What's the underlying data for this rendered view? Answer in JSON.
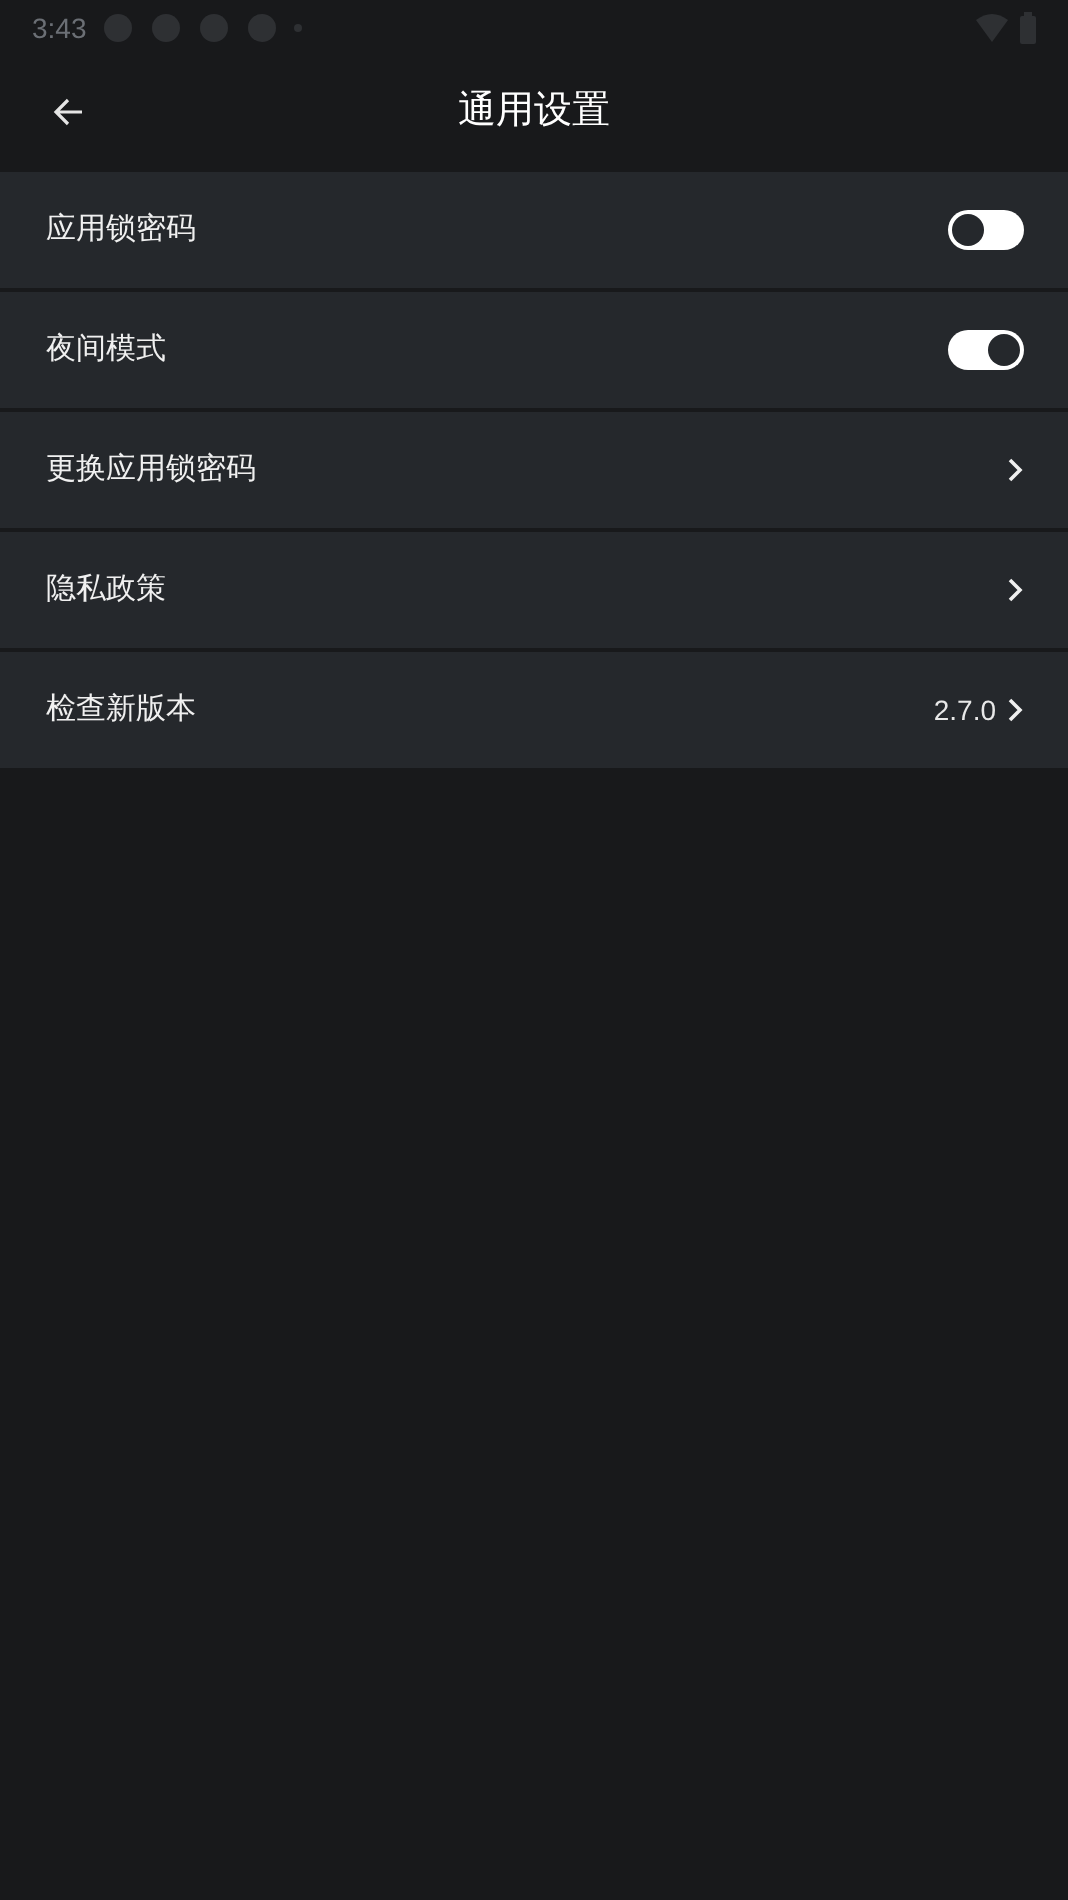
{
  "status_bar": {
    "time": "3:43"
  },
  "header": {
    "title": "通用设置"
  },
  "settings": [
    {
      "kind": "toggle",
      "label": "应用锁密码",
      "on": false
    },
    {
      "kind": "toggle",
      "label": "夜间模式",
      "on": true
    },
    {
      "kind": "link",
      "label": "更换应用锁密码"
    },
    {
      "kind": "link",
      "label": "隐私政策"
    },
    {
      "kind": "link",
      "label": "检查新版本",
      "value": "2.7.0"
    }
  ]
}
